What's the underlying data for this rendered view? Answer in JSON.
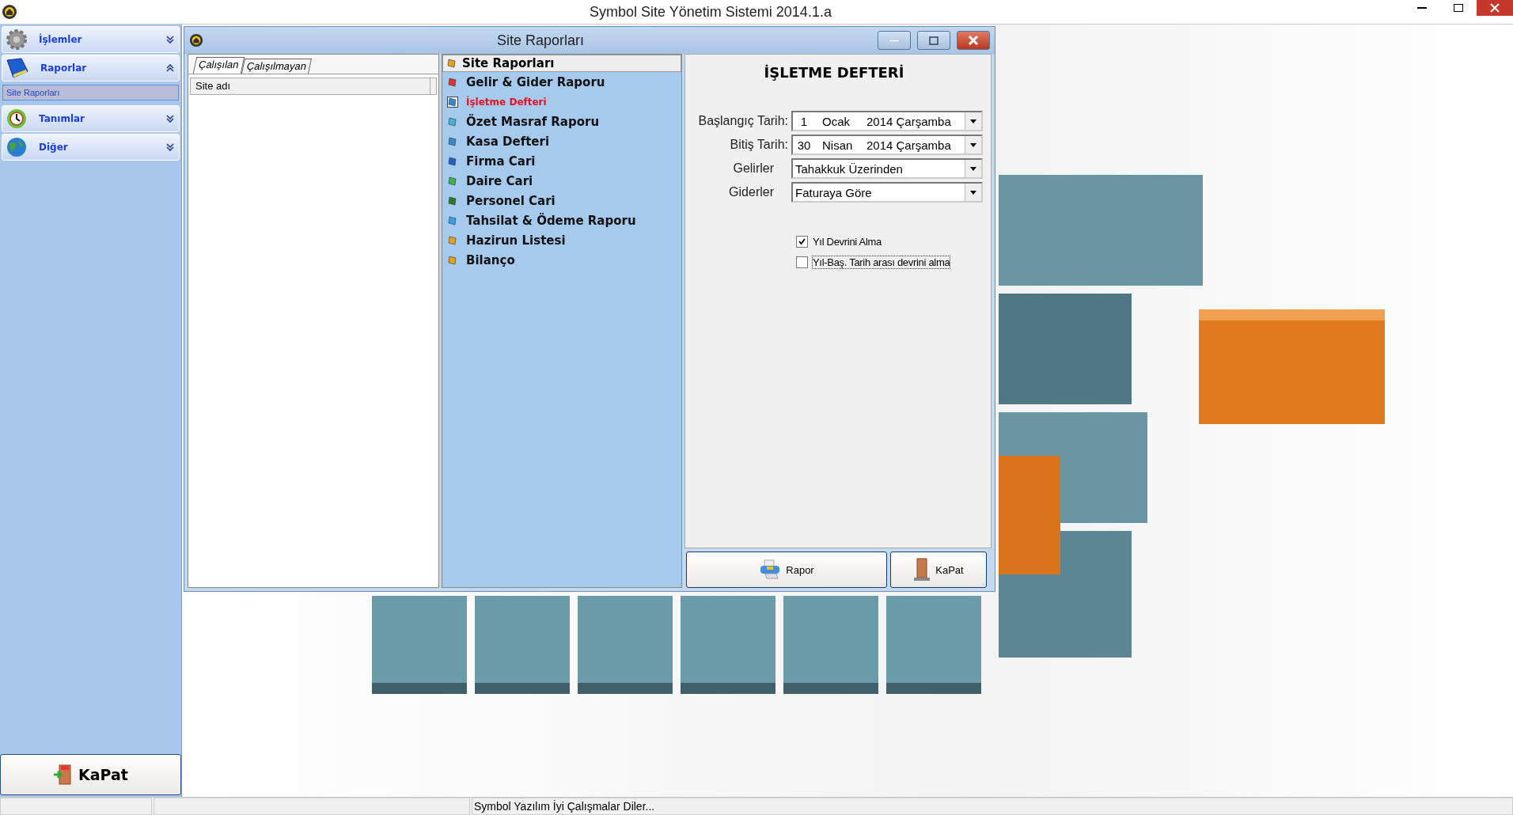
{
  "app": {
    "title": "Symbol Site Yönetim Sistemi 2014.1.a"
  },
  "sidebar": {
    "groups": [
      {
        "kind": "gear",
        "label": "İşlemler",
        "expanded": false
      },
      {
        "kind": "book",
        "label": "Raporlar",
        "expanded": true,
        "items": [
          {
            "label": "Site Raporları",
            "selected": true
          }
        ]
      },
      {
        "kind": "clock",
        "label": "Tanımlar",
        "expanded": false
      },
      {
        "kind": "globe",
        "label": "Diğer",
        "expanded": false
      }
    ],
    "close_button": "KaPat"
  },
  "dialog": {
    "title": "Site Raporları",
    "site_list": {
      "tabs": [
        {
          "label": "Çalışılan",
          "selected": true
        },
        {
          "label": "Çalışılmayan",
          "selected": false
        }
      ],
      "columns": [
        "Site adı"
      ]
    },
    "report_list": {
      "header": "Site Raporları",
      "items": [
        {
          "label": "Gelir & Gider Raporu",
          "selected": false
        },
        {
          "label": "İşletme Defteri",
          "selected": true
        },
        {
          "label": "Özet Masraf Raporu",
          "selected": false
        },
        {
          "label": "Kasa Defteri",
          "selected": false
        },
        {
          "label": "Firma Cari",
          "selected": false
        },
        {
          "label": "Daire Cari",
          "selected": false
        },
        {
          "label": "Personel Cari",
          "selected": false
        },
        {
          "label": "Tahsilat & Ödeme Raporu",
          "selected": false
        },
        {
          "label": "Hazirun Listesi",
          "selected": false
        },
        {
          "label": "Bilanço",
          "selected": false
        }
      ]
    },
    "form": {
      "title": "İŞLETME DEFTERİ",
      "fields": [
        {
          "kind": "date",
          "label": "Başlangıç Tarih:",
          "day": "1",
          "month": "Ocak",
          "year_day": "2014 Çarşamba"
        },
        {
          "kind": "date",
          "label": "Bitiş Tarih:",
          "day": "30",
          "month": "Nisan",
          "year_day": "2014 Çarşamba"
        },
        {
          "kind": "combo",
          "label": "Gelirler",
          "value": "Tahakkuk Üzerinden"
        },
        {
          "kind": "combo",
          "label": "Giderler",
          "value": "Faturaya Göre"
        }
      ],
      "checkboxes": [
        {
          "label": "Yıl Devrini Alma",
          "checked": true,
          "focused": false
        },
        {
          "label": "Yıl-Baş. Tarih arası devrini alma",
          "checked": false,
          "focused": true
        }
      ]
    },
    "buttons": [
      {
        "kind": "printer",
        "label": "Rapor"
      },
      {
        "kind": "door",
        "label": "KaPat"
      }
    ]
  },
  "status_bar": {
    "message": "Symbol Yazılım İyi Çalışmalar Diler..."
  }
}
